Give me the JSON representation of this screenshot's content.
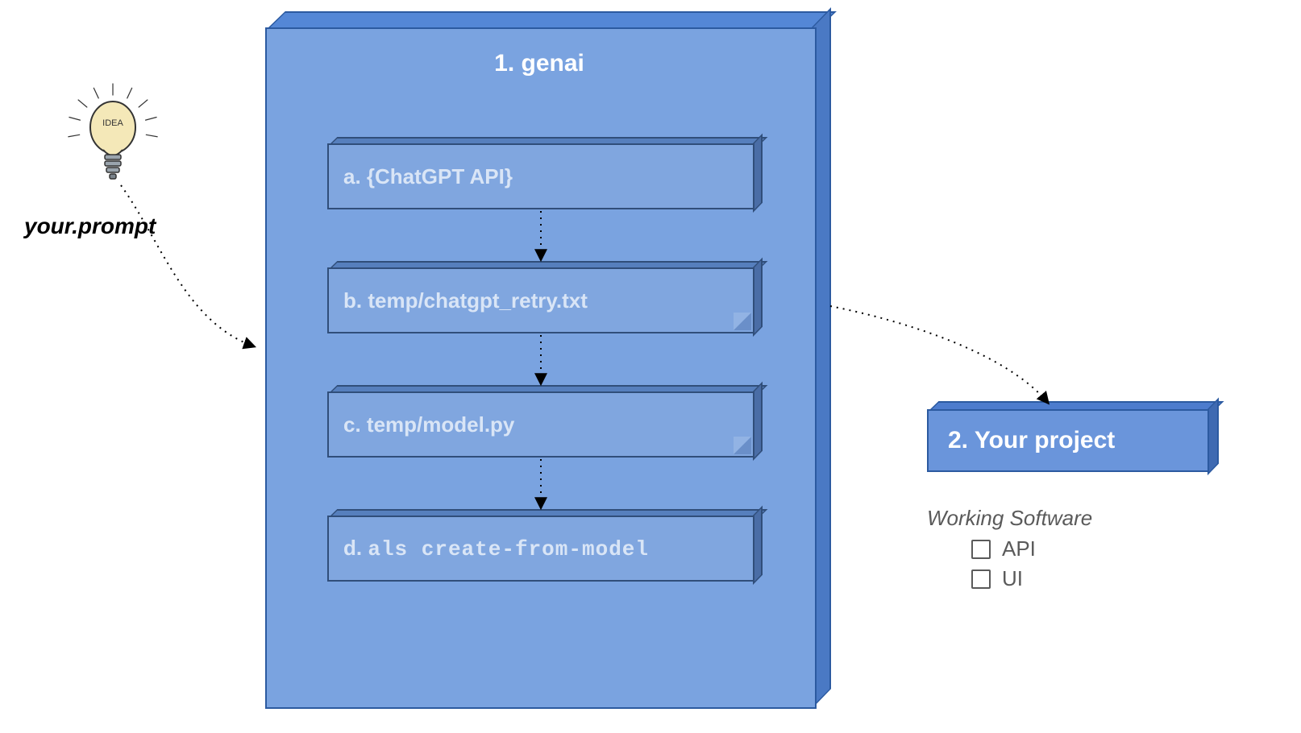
{
  "input_label": "your.prompt",
  "main_box": {
    "title": "1. genai",
    "steps": [
      {
        "id": "a",
        "label": "a. {ChatGPT API}",
        "kind": "box"
      },
      {
        "id": "b",
        "label": "b. temp/chatgpt_retry.txt",
        "kind": "note"
      },
      {
        "id": "c",
        "label": "c. temp/model.py",
        "kind": "note"
      },
      {
        "id": "d",
        "prefix": "d.",
        "command": "als create-from-model",
        "kind": "box"
      }
    ]
  },
  "project_box": {
    "title": "2. Your project"
  },
  "subtitle": "Working Software",
  "outputs": [
    "API",
    "UI"
  ],
  "idea_icon_text": "IDEA"
}
